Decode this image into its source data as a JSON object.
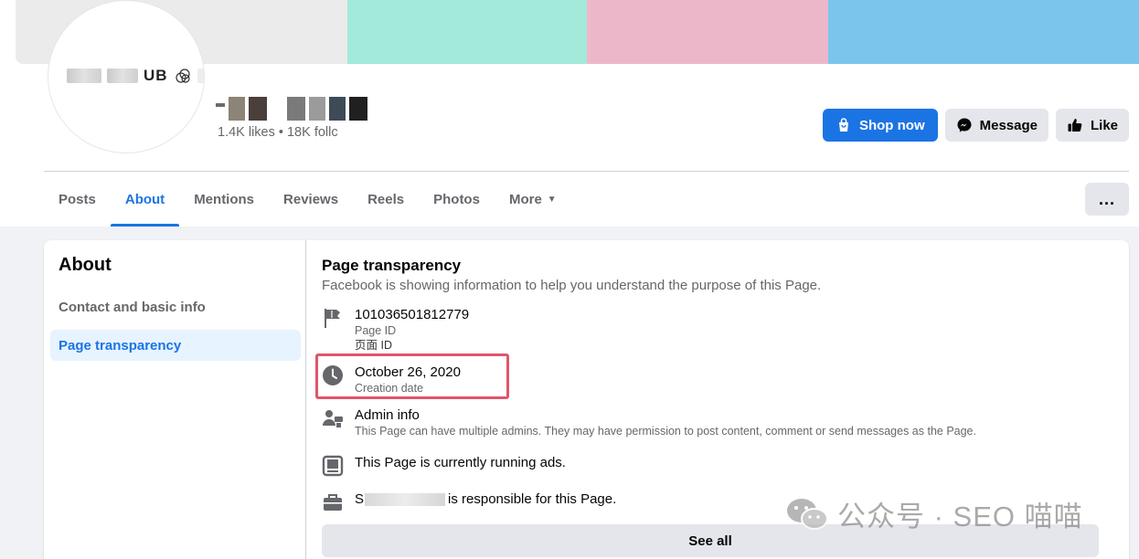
{
  "colors": {
    "accent": "#1b74e4",
    "cover": [
      "#ebebeb",
      "#a3eadb",
      "#edb7ca",
      "#7bc5ea"
    ],
    "highlight": "#e0566b"
  },
  "header": {
    "avatar_logo_text": "UB",
    "stats": "1.4K likes • 18K follc",
    "buttons": {
      "shop": "Shop now",
      "message": "Message",
      "like": "Like",
      "more": "..."
    }
  },
  "tabs": [
    {
      "label": "Posts",
      "active": false
    },
    {
      "label": "About",
      "active": true
    },
    {
      "label": "Mentions",
      "active": false
    },
    {
      "label": "Reviews",
      "active": false
    },
    {
      "label": "Reels",
      "active": false
    },
    {
      "label": "Photos",
      "active": false
    },
    {
      "label": "More",
      "active": false
    }
  ],
  "sidebar": {
    "title": "About",
    "items": [
      {
        "label": "Contact and basic info",
        "active": false
      },
      {
        "label": "Page transparency",
        "active": true
      }
    ]
  },
  "transparency": {
    "title": "Page transparency",
    "description": "Facebook is showing information to help you understand the purpose of this Page.",
    "page_id": {
      "value": "101036501812779",
      "label": "Page ID",
      "label_zh": "页面 ID",
      "icon": "flag-icon"
    },
    "creation": {
      "value": "October 26, 2020",
      "label": "Creation date",
      "icon": "clock-icon"
    },
    "admin": {
      "title": "Admin info",
      "text": "This Page can have multiple admins. They may have permission to post content, comment or send messages as the Page.",
      "icon": "admin-icon"
    },
    "ads": {
      "text": "This Page is currently running ads.",
      "icon": "ads-icon"
    },
    "responsible": {
      "prefix": "S",
      "suffix": "is responsible for this Page.",
      "icon": "briefcase-icon"
    },
    "see_all": "See all"
  },
  "watermark": {
    "text": "公众号 · SEO 喵喵"
  }
}
